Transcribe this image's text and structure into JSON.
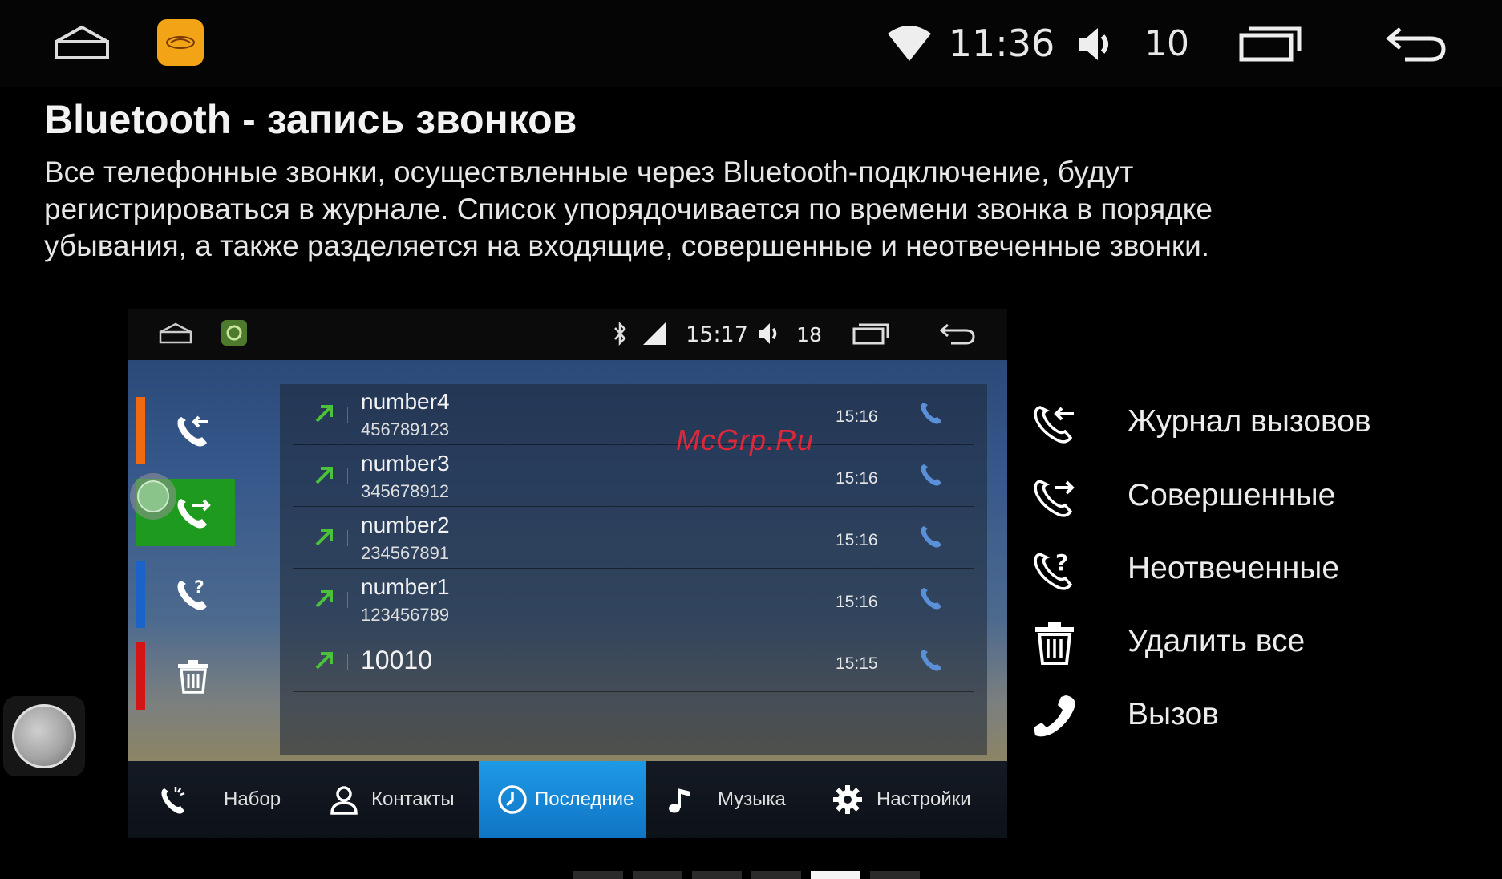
{
  "status_bar": {
    "time": "11:36",
    "volume": "10",
    "icons": [
      "home-icon",
      "app-logo-icon",
      "wifi-icon",
      "volume-icon",
      "recent-apps-icon",
      "back-icon"
    ]
  },
  "header": {
    "title": "Bluetooth - запись звонков",
    "description_lines": [
      "Все телефонные звонки, осуществленные через Bluetooth-подключение, будут",
      "регистрироваться в журнале. Список упорядочивается по времени звонка в порядке",
      "убывания, а также разделяется на входящие, совершенные и неотвеченные звонки."
    ]
  },
  "screenshot": {
    "status_bar": {
      "time": "15:17",
      "volume": "18",
      "icons": [
        "home-icon",
        "app-icon",
        "bluetooth-icon",
        "signal-icon",
        "volume-icon",
        "recent-apps-icon",
        "back-icon"
      ]
    },
    "sidebar": [
      {
        "icon": "call-log-icon",
        "strip_color": "#f06a10"
      },
      {
        "icon": "outgoing-calls-icon",
        "strip_color": "#1e9b1e",
        "active": true
      },
      {
        "icon": "missed-calls-icon",
        "strip_color": "#1a63c9"
      },
      {
        "icon": "trash-icon",
        "strip_color": "#d41515"
      }
    ],
    "calls": [
      {
        "name": "number4",
        "number": "456789123",
        "time": "15:16"
      },
      {
        "name": "number3",
        "number": "345678912",
        "time": "15:16"
      },
      {
        "name": "number2",
        "number": "234567891",
        "time": "15:16"
      },
      {
        "name": "number1",
        "number": "123456789",
        "time": "15:16"
      },
      {
        "name": "10010",
        "number": "",
        "time": "15:15"
      }
    ],
    "tabs": [
      {
        "label": "Набор",
        "icon": "dial-icon"
      },
      {
        "label": "Контакты",
        "icon": "contacts-icon"
      },
      {
        "label": "Последние",
        "icon": "clock-icon",
        "active": true
      },
      {
        "label": "Музыка",
        "icon": "music-icon"
      },
      {
        "label": "Настройки",
        "icon": "settings-gear-icon"
      }
    ]
  },
  "legend": [
    {
      "label": "Журнал вызовов",
      "icon": "call-log-icon"
    },
    {
      "label": "Совершенные",
      "icon": "outgoing-calls-icon"
    },
    {
      "label": "Неотвеченные",
      "icon": "missed-calls-icon"
    },
    {
      "label": "Удалить все",
      "icon": "trash-icon"
    },
    {
      "label": "Вызов",
      "icon": "phone-call-icon"
    }
  ],
  "watermark": "McGrp.Ru",
  "colors": {
    "accent_blue": "#1e9ae6",
    "green_arrow": "#4cc23a",
    "active_side": "#1e9b1e"
  }
}
